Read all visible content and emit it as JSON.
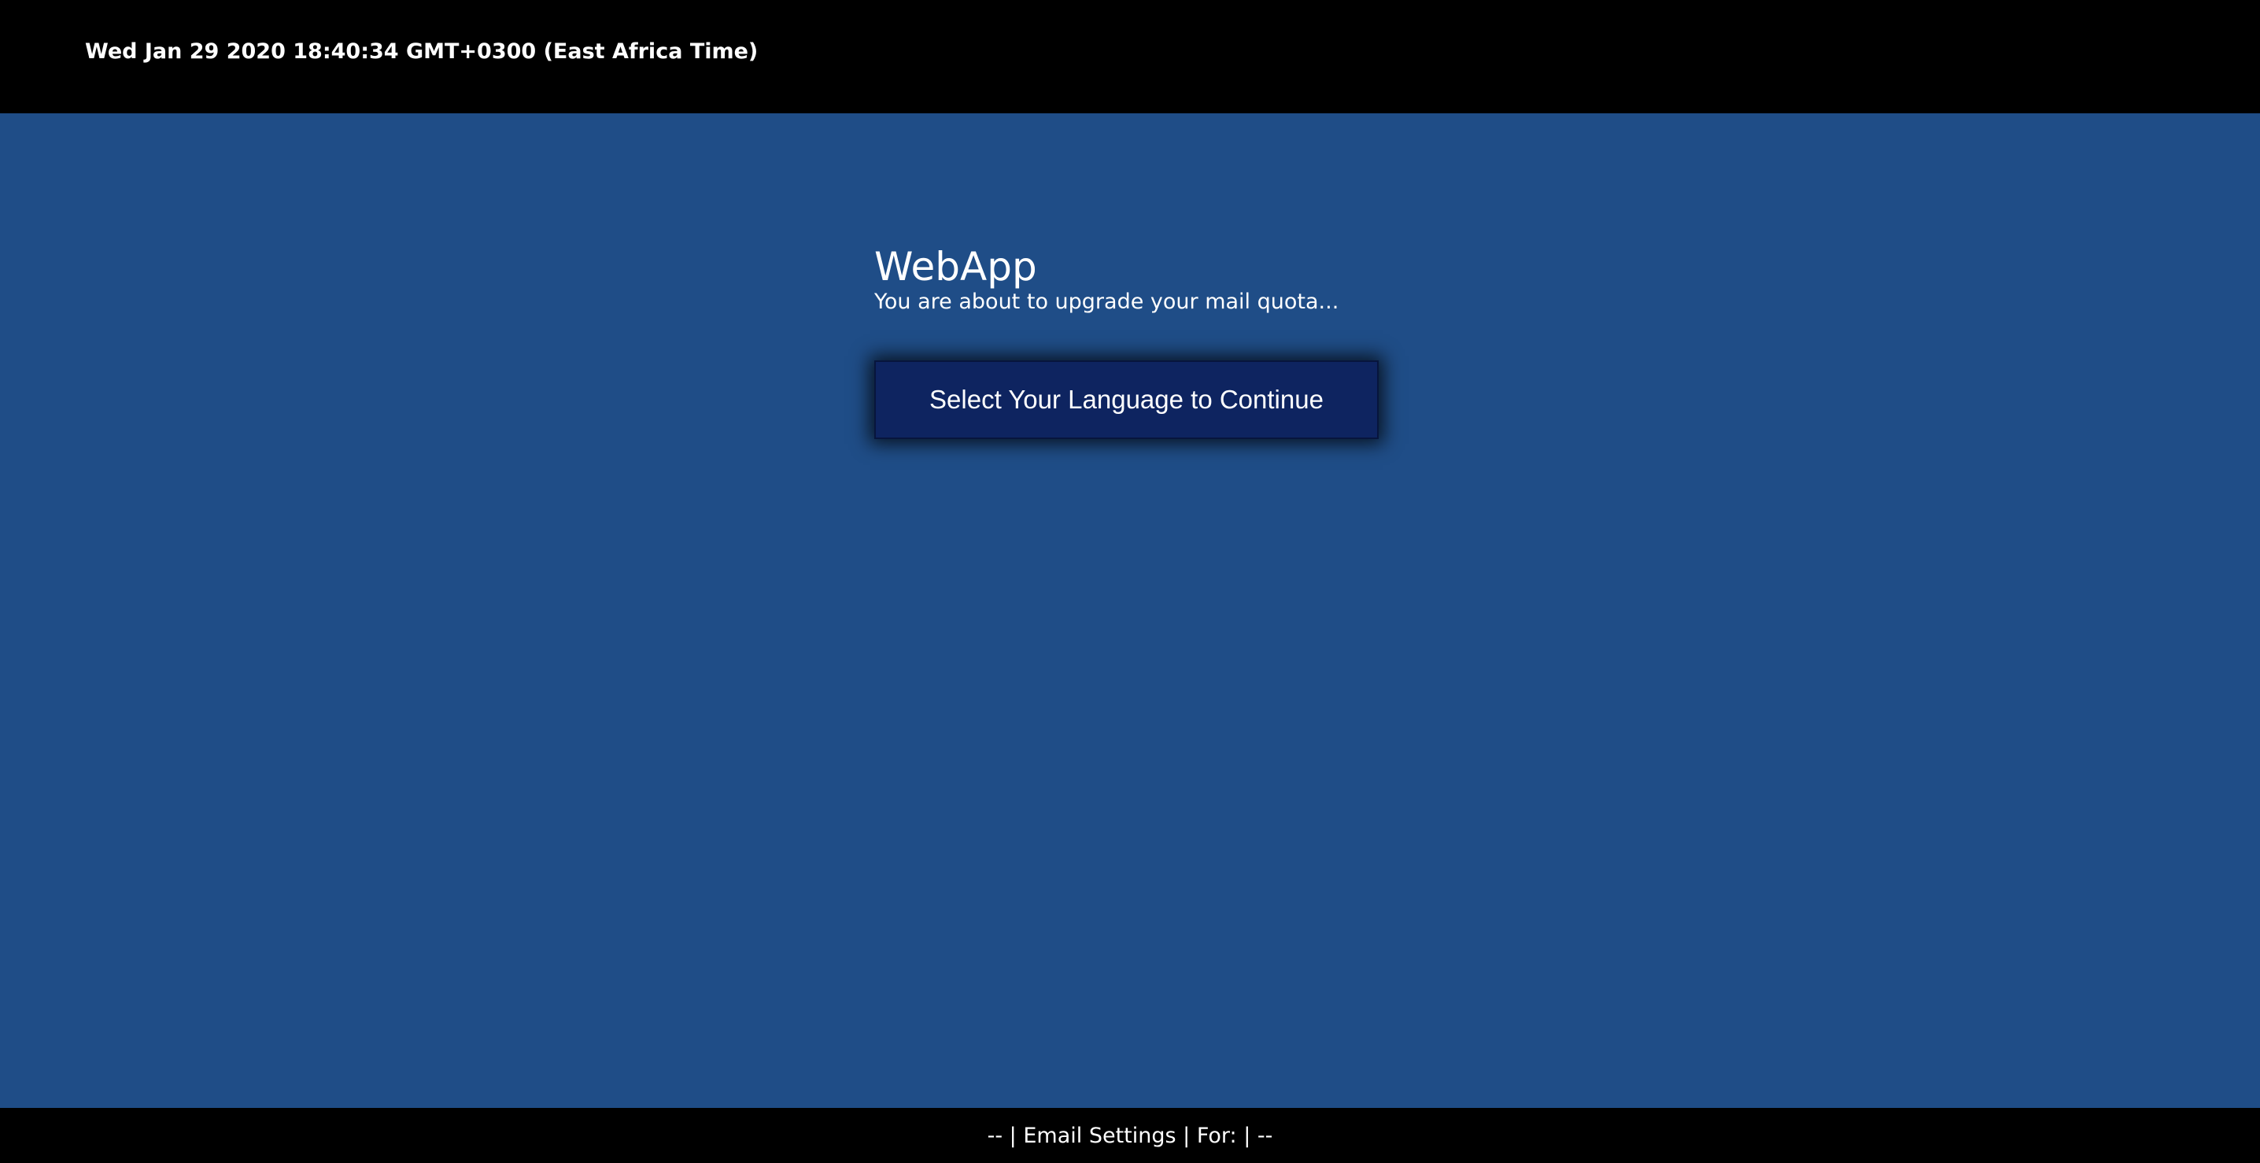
{
  "header": {
    "datetime": "Wed Jan 29 2020 18:40:34 GMT+0300 (East Africa Time)"
  },
  "main": {
    "title": "WebApp",
    "subtitle": "You are about to upgrade your mail quota...",
    "continue_button_label": "Select Your Language to Continue"
  },
  "footer": {
    "text": "-- | Email Settings | For: | --"
  },
  "colors": {
    "background": "#1f4d87",
    "bars": "#000000",
    "button": "#0e2460",
    "text": "#ffffff"
  }
}
